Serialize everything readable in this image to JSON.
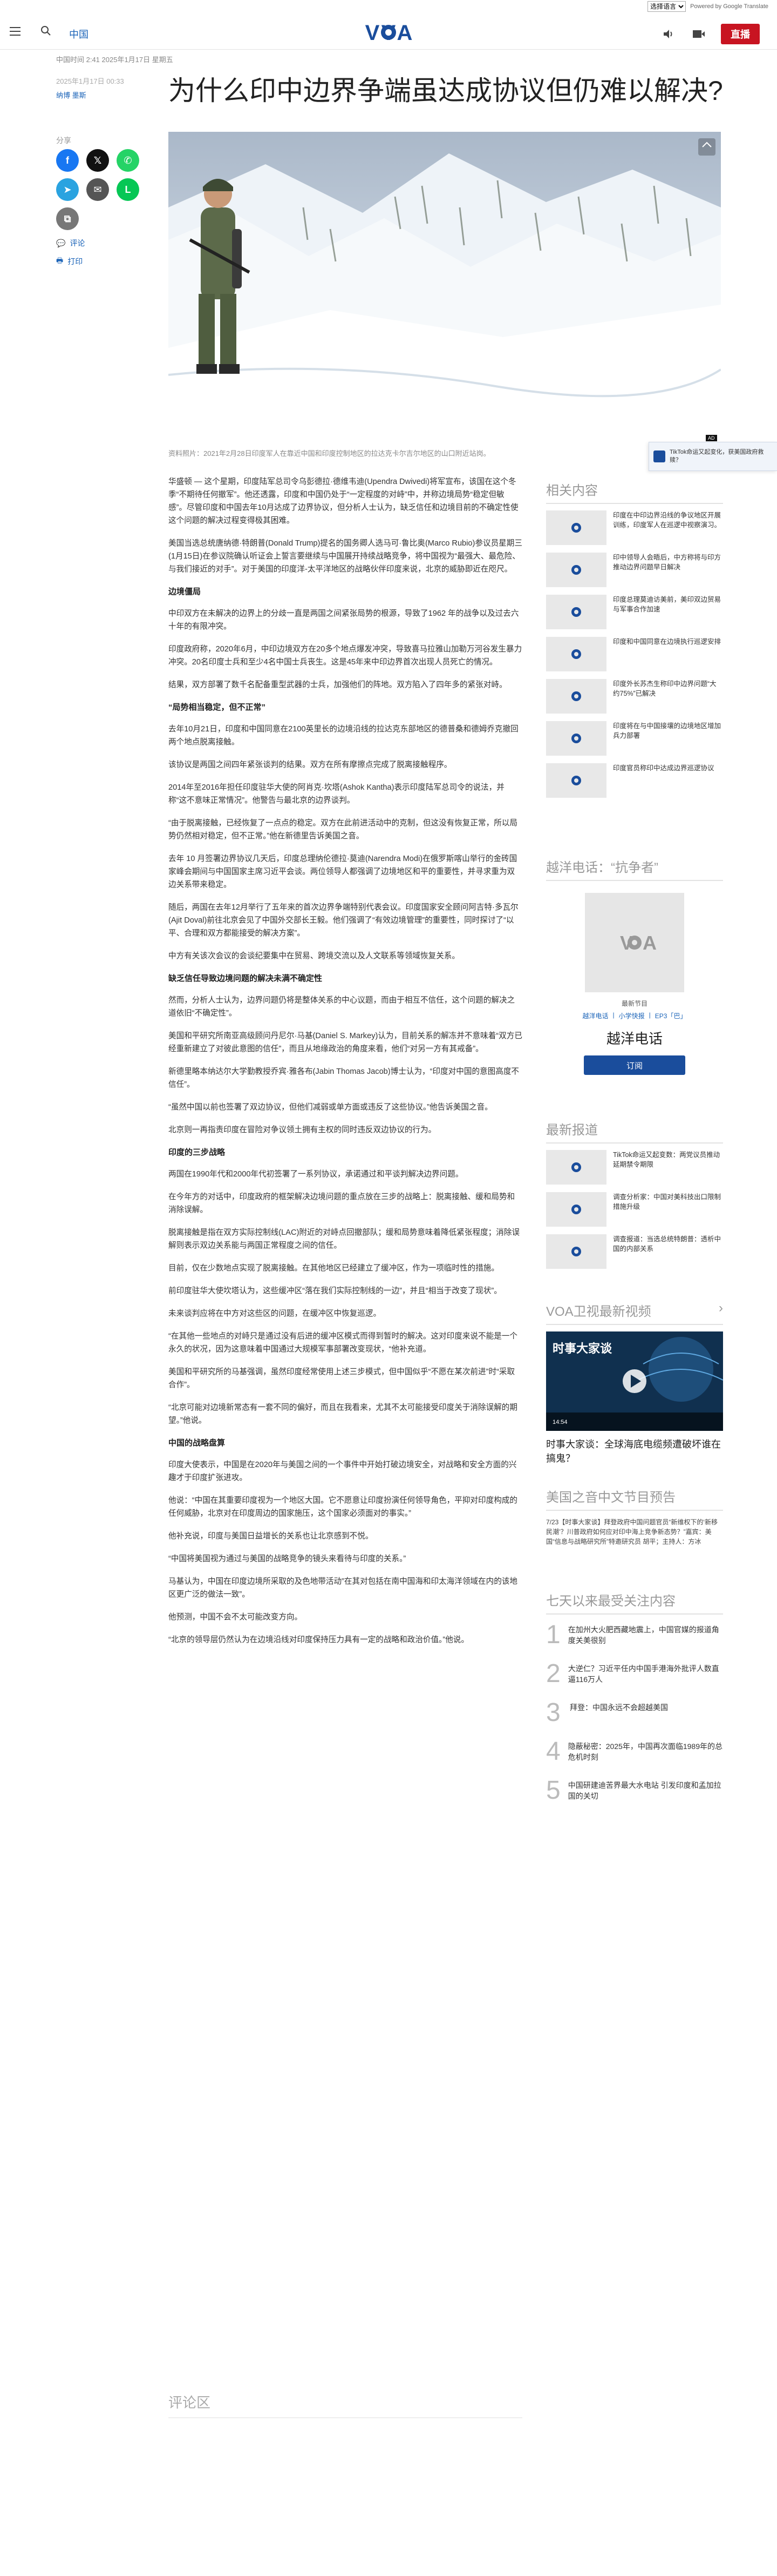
{
  "translate": {
    "select_label": "选择语言",
    "powered": "Powered by Google Translate"
  },
  "header": {
    "section": "中国",
    "live_label": "直播"
  },
  "meta": {
    "updated": "中国时间 2:41 2025年1月17日 星期五",
    "date": "2025年1月17日 00:33",
    "author": "纳博 墨斯"
  },
  "headline": "为什么印中边界争端虽达成协议但仍难以解决?",
  "share": {
    "label": "分享",
    "comment_label": "评论",
    "print_label": "打印"
  },
  "hero": {
    "caption": "资料照片：2021年2月28日印度军人在靠近中国和印度控制地区的拉达克卡尔吉尔地区的山口附近站岗。",
    "ad_label": "AD"
  },
  "tiktok": {
    "label": "TikTok命运又起变化，获美国政府救赎？"
  },
  "article": {
    "paragraphs": [
      "华盛顿 — 这个星期，印度陆军总司令乌彭德拉·德维韦迪(Upendra Dwivedi)将军宣布，该国在这个冬季“不期待任何撤军”。他还透露，印度和中国仍处于“一定程度的对峙”中，并称边境局势“稳定但敏感”。尽管印度和中国去年10月达成了边界协议，但分析人士认为，缺乏信任和边境目前的不确定性使这个问题的解决过程变得极其困难。",
      "美国当选总统唐纳德·特朗普(Donald Trump)提名的国务卿人选马可·鲁比奥(Marco Rubio)参议员星期三(1月15日)在参议院确认听证会上誓言要继续与中国展开持续战略竞争，将中国视为“最强大、最危险、与我们接近的对手”。对于美国的印度洋-太平洋地区的战略伙伴印度来说，北京的威胁即近在咫尺。"
    ],
    "h_border": "边境僵局",
    "border_paras": [
      "中印双方在未解决的边界上的分歧一直是两国之间紧张局势的根源，导致了1962 年的战争以及过去六十年的有限冲突。",
      "印度政府称，2020年6月，中印边境双方在20多个地点爆发冲突，导致喜马拉雅山加勒万河谷发生暴力冲突。20名印度士兵和至少4名中国士兵丧生。这是45年来中印边界首次出现人员死亡的情况。",
      "结果，双方部署了数千名配备重型武器的士兵，加强他们的阵地。双方陷入了四年多的紧张对峙。"
    ],
    "h_progress": "“局势相当稳定，但不正常”",
    "progress_paras": [
      "去年10月21日，印度和中国同意在2100英里长的边境沿线的拉达克东部地区的德普桑和德姆乔克撤回两个地点脱离接触。",
      "该协议是两国之间四年紧张谈判的结果。双方在所有摩擦点完成了脱离接触程序。",
      "2014年至2016年担任印度驻华大使的阿肖克·坎塔(Ashok Kantha)表示印度陆军总司令的说法，并称“这不意味正常情况”。他警告与最北京的边界谈判。",
      "“由于脱离接触，已经恢复了一点点的稳定。双方在此前进活动中的克制，但这没有恢复正常，所以局势仍然相对稳定，但不正常。”他在新德里告诉美国之音。",
      "去年 10 月签署边界协议几天后，印度总理纳伦德拉·莫迪(Narendra Modi)在俄罗斯喀山举行的金砖国家峰会期间与中国国家主席习近平会谈。两位领导人都强调了边境地区和平的重要性，并寻求重为双边关系带来稳定。",
      "随后，两国在去年12月举行了五年来的首次边界争端特别代表会议。印度国家安全顾问阿吉特·多瓦尔(Ajit Doval)前往北京会见了中国外交部长王毅。他们强调了“有效边境管理”的重要性，同时探讨了“以平、合理和双方都能接受的解决方案”。",
      "中方有关该次会议的会谈纪要集中在贸易、跨境交流以及人文联系等领域恢复关系。"
    ],
    "h_trust": "缺乏信任导致边境问题的解决未满不确定性",
    "trust_paras": [
      "然而，分析人士认为，边界问题仍将是整体关系的中心议题，而由于相互不信任，这个问题的解决之道依旧“不确定性”。",
      "美国和平研究所南亚高级顾问丹尼尔·马基(Daniel S. Markey)认为，目前关系的解冻并不意味着“双方已经重新建立了对彼此意图的信任”，而且从地缘政治的角度来看，他们“对另一方有其戒备”。",
      "新德里略本纳达尔大学勤教授乔宾·雅各布(Jabin Thomas Jacob)博士认为，“印度对中国的意图高度不信任”。",
      "“虽然中国以前也签署了双边协议，但他们减弱或单方面或违反了这些协议。”他告诉美国之音。",
      "北京则一再指责印度在冒险对争议领土拥有主权的同时违反双边协议的行为。"
    ],
    "h_buffer": "印度的三步战略",
    "buffer_paras": [
      "两国在1990年代和2000年代初签署了一系列协议，承诺通过和平谈判解决边界问题。",
      "在今年方的对话中，印度政府的框架解决边境问题的重点放在三步的战略上：脱离接触、缓和局势和消除误解。",
      "脱离接触是指在双方实际控制线(LAC)附近的对峙点回撤部队；缓和局势意味着降低紧张程度；消除误解则表示双边关系能与两国正常程度之间的信任。",
      "目前，仅在少数地点实现了脱离接触。在其他地区已经建立了缓冲区，作为一项临时性的措施。",
      "前印度驻华大使坎塔认为，这些缓冲区“落在我们实际控制线的一边”，并且“相当于改变了现状”。",
      "未来谈判应将在中方对这些区的问题，在缓冲区中恢复巡逻。",
      "“在其他一些地点的对峙只是通过没有后进的缓冲区模式而得到暂时的解决。这对印度来说不能是一个永久的状况，因为这意味着中国通过大规模军事部署改变现状，“他补充道。",
      "美国和平研究所的马基强调，虽然印度经常使用上述三步模式，但中国似乎“不愿在某次前进”时“采取合作”。",
      "“北京可能对边境新常态有一套不同的偏好，而且在我看来，尤其不太可能接受印度关于消除误解的期望。”他说。"
    ],
    "h_china": "中国的战略盘算",
    "china_paras": [
      "印度大使表示，中国是在2020年与美国之间的一个事件中开始打破边境安全，对战略和安全方面的兴趣才于印度扩张进攻。",
      "他说：“中国在其重要印度视为一个地区大国。它不愿意让印度扮演任何领导角色，平抑对印度构成的任何威胁，北京对在印度周边的国家施压，这个国家必须面对的事实。”",
      "他补充说，印度与美国日益增长的关系也让北京感到不悦。",
      "“中国将美国视为通过与美国的战略竞争的镜头来看待与印度的关系。”",
      "马基认为，中国在印度边境所采取的及色地带活动”在其对包括在南中国海和印太海洋领域在内的该地区更广泛的做法一致”。",
      "他预测，中国不会不太可能改变方向。",
      "“北京的领导层仍然认为在边境沿线对印度保持压力具有一定的战略和政治价值。”他说。"
    ]
  },
  "comments_title": "评论区",
  "sidebar": {
    "related_title": "相关内容",
    "related": [
      "印度在中印边界沿线的争议地区开展训练，印度军人在巡逻中视察演习。",
      "印中领导人会晤后，中方称将与印方推动边界问题早日解决",
      "印度总理莫迪访美前，美印双边贸易与军事合作加速",
      "印度和中国同意在边境执行巡逻安排",
      "印度外长苏杰生称印中边界问题“大约75%”已解决",
      "印度将在与中国接壤的边境地区增加兵力部署",
      "印度官员称印中达成边界巡逻协议"
    ],
    "hotline_title": "越洋电话：“抗争者”",
    "hotline_program": "最新节目",
    "hotline_links": [
      "越洋电话",
      "小学快报",
      "EP3「巴」"
    ],
    "hotline_name": "越洋电话",
    "subscribe": "订阅",
    "latest_title": "最新报道",
    "latest": [
      "TikTok命运又起变数：两党议员推动延期禁令期限",
      "调查分析家：中国对美科技出口限制措施升级",
      "调查报道：当选总统特朗普：透析中国的内部关系"
    ],
    "video_title": "VOA卫视最新视频",
    "video_overlay": "时事大家谈",
    "video_time": "14:54",
    "video_caption": "时事大家谈：全球海底电缆频遭破坏谁在搞鬼？",
    "preview_title": "美国之音中文节目预告",
    "preview_text": "7/23【时事大家谈】拜登政府中国问题官员“新维权下的‘新移民潮’？川普政府如何应对印中海上竞争新态势？”嘉宾：美国“信息与战略研究所”特邀研究员 胡平；主持人：方冰",
    "top_title": "七天以来最受关注内容",
    "top": [
      "在加州大火肥西藏地震上，中国官媒的报道角度关美很别",
      "大逆仁？习近平任内中国手港海外批评人数直逼116万人",
      "拜登：中国永远不会超越美国",
      "隐蔽秘密：2025年，中国再次面临1989年的总危机时刻",
      "中国研建迪苦界最大水电站 引发印度和孟加拉国的关切"
    ]
  },
  "colors": {
    "accent": "#1a63b8",
    "live": "#c81421",
    "muted": "#999999"
  }
}
